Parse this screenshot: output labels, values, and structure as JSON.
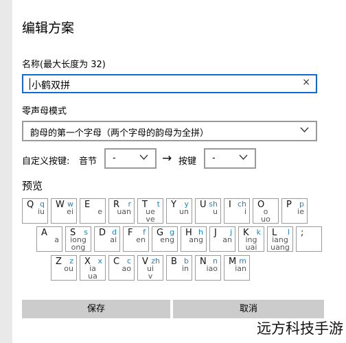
{
  "dialog": {
    "title": "编辑方案",
    "name_label": "名称(最大长度为 32)",
    "name_value": "小鹤双拼",
    "clear_glyph": "×",
    "mode_label": "零声母模式",
    "mode_value": "韵母的第一个字母（两个字母的韵母为全拼）",
    "custom_label": "自定义按键:",
    "syllable_label": "音节",
    "syllable_value": "-",
    "arrow_glyph": "→",
    "key_label": "按键",
    "key_value": "-",
    "preview_label": "预览",
    "save_label": "保存",
    "cancel_label": "取消"
  },
  "keyboard": {
    "row1": [
      {
        "key": "Q",
        "initial": "q",
        "finals": [
          "iu"
        ]
      },
      {
        "key": "W",
        "initial": "w",
        "finals": [
          "ei"
        ]
      },
      {
        "key": "E",
        "initial": "",
        "finals": [
          "e"
        ]
      },
      {
        "key": "R",
        "initial": "r",
        "finals": [
          "uan"
        ]
      },
      {
        "key": "T",
        "initial": "t",
        "finals": [
          "ue",
          "ve"
        ]
      },
      {
        "key": "Y",
        "initial": "y",
        "finals": [
          "un"
        ]
      },
      {
        "key": "U",
        "initial": "sh",
        "finals": [
          "u"
        ]
      },
      {
        "key": "I",
        "initial": "ch",
        "finals": [
          "i"
        ]
      },
      {
        "key": "O",
        "initial": "",
        "finals": [
          "o",
          "uo"
        ]
      },
      {
        "key": "P",
        "initial": "p",
        "finals": [
          "ie"
        ]
      }
    ],
    "row2": [
      {
        "key": "A",
        "initial": "",
        "finals": [
          "a"
        ]
      },
      {
        "key": "S",
        "initial": "s",
        "finals": [
          "iong",
          "ong"
        ]
      },
      {
        "key": "D",
        "initial": "d",
        "finals": [
          "ai"
        ]
      },
      {
        "key": "F",
        "initial": "f",
        "finals": [
          "en"
        ]
      },
      {
        "key": "G",
        "initial": "g",
        "finals": [
          "eng"
        ]
      },
      {
        "key": "H",
        "initial": "h",
        "finals": [
          "ang"
        ]
      },
      {
        "key": "J",
        "initial": "j",
        "finals": [
          "an"
        ]
      },
      {
        "key": "K",
        "initial": "k",
        "finals": [
          "ing",
          "uai"
        ]
      },
      {
        "key": "L",
        "initial": "l",
        "finals": [
          "iang",
          "uang"
        ]
      },
      {
        "key": ";",
        "initial": "",
        "finals": []
      }
    ],
    "row3": [
      {
        "key": "Z",
        "initial": "z",
        "finals": [
          "ou"
        ]
      },
      {
        "key": "X",
        "initial": "x",
        "finals": [
          "ia",
          "ua"
        ]
      },
      {
        "key": "C",
        "initial": "c",
        "finals": [
          "ao"
        ]
      },
      {
        "key": "V",
        "initial": "zh",
        "finals": [
          "ui",
          "v"
        ]
      },
      {
        "key": "B",
        "initial": "b",
        "finals": [
          "in"
        ]
      },
      {
        "key": "N",
        "initial": "n",
        "finals": [
          "iao"
        ]
      },
      {
        "key": "M",
        "initial": "m",
        "finals": [
          "ian"
        ]
      }
    ]
  },
  "watermark": "远方科技手游"
}
